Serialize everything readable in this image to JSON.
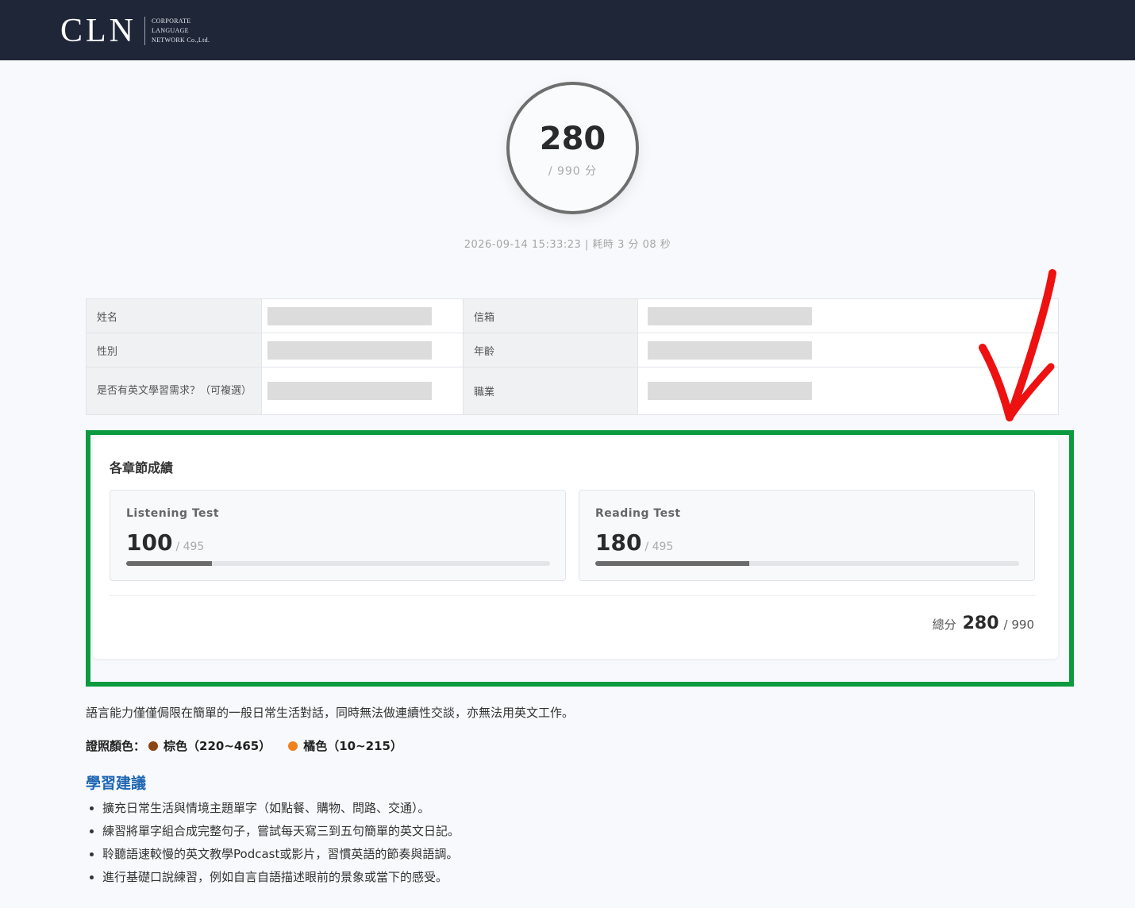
{
  "header": {
    "logo_mark": "CLN",
    "logo_lines": [
      "CORPORATE",
      "LANGUAGE",
      "NETWORK Co.,Ltd."
    ]
  },
  "score": {
    "total": "280",
    "max_label": "/ 990 分"
  },
  "meta": "2026-09-14 15:33:23 | 耗時 3 分 08 秒",
  "info": {
    "name_label": "姓名",
    "email_label": "信箱",
    "gender_label": "性別",
    "age_label": "年齡",
    "need_label": "是否有英文學習需求？（可複選）",
    "job_label": "職業"
  },
  "sections": {
    "title": "各章節成績",
    "items": [
      {
        "name": "Listening Test",
        "score": "100",
        "max": "/ 495",
        "fraction": 0.202
      },
      {
        "name": "Reading Test",
        "score": "180",
        "max": "/ 495",
        "fraction": 0.364
      }
    ],
    "total_label": "總分",
    "total_value": "280",
    "total_max": "/ 990"
  },
  "description": "語言能力僅僅侷限在簡單的一般日常生活對話，同時無法做連續性交談，亦無法用英文工作。",
  "certificate": {
    "label": "證照顏色：",
    "items": [
      {
        "text": "棕色（220~465）",
        "color": "#8b4513"
      },
      {
        "text": "橘色（10~215）",
        "color": "#f0821e"
      }
    ]
  },
  "advice": {
    "title": "學習建議",
    "items": [
      "擴充日常生活與情境主題單字（如點餐、購物、問路、交通）。",
      "練習將單字組合成完整句子，嘗試每天寫三到五句簡單的英文日記。",
      "聆聽語速較慢的英文教學Podcast或影片，習慣英語的節奏與語調。",
      "進行基礎口說練習，例如自言自語描述眼前的景象或當下的感受。"
    ]
  },
  "colors": {
    "header_bg": "#1f2638",
    "highlight_box": "#0c9a40",
    "annotation_arrow": "#ee1111",
    "advice_title": "#1f66b3"
  }
}
